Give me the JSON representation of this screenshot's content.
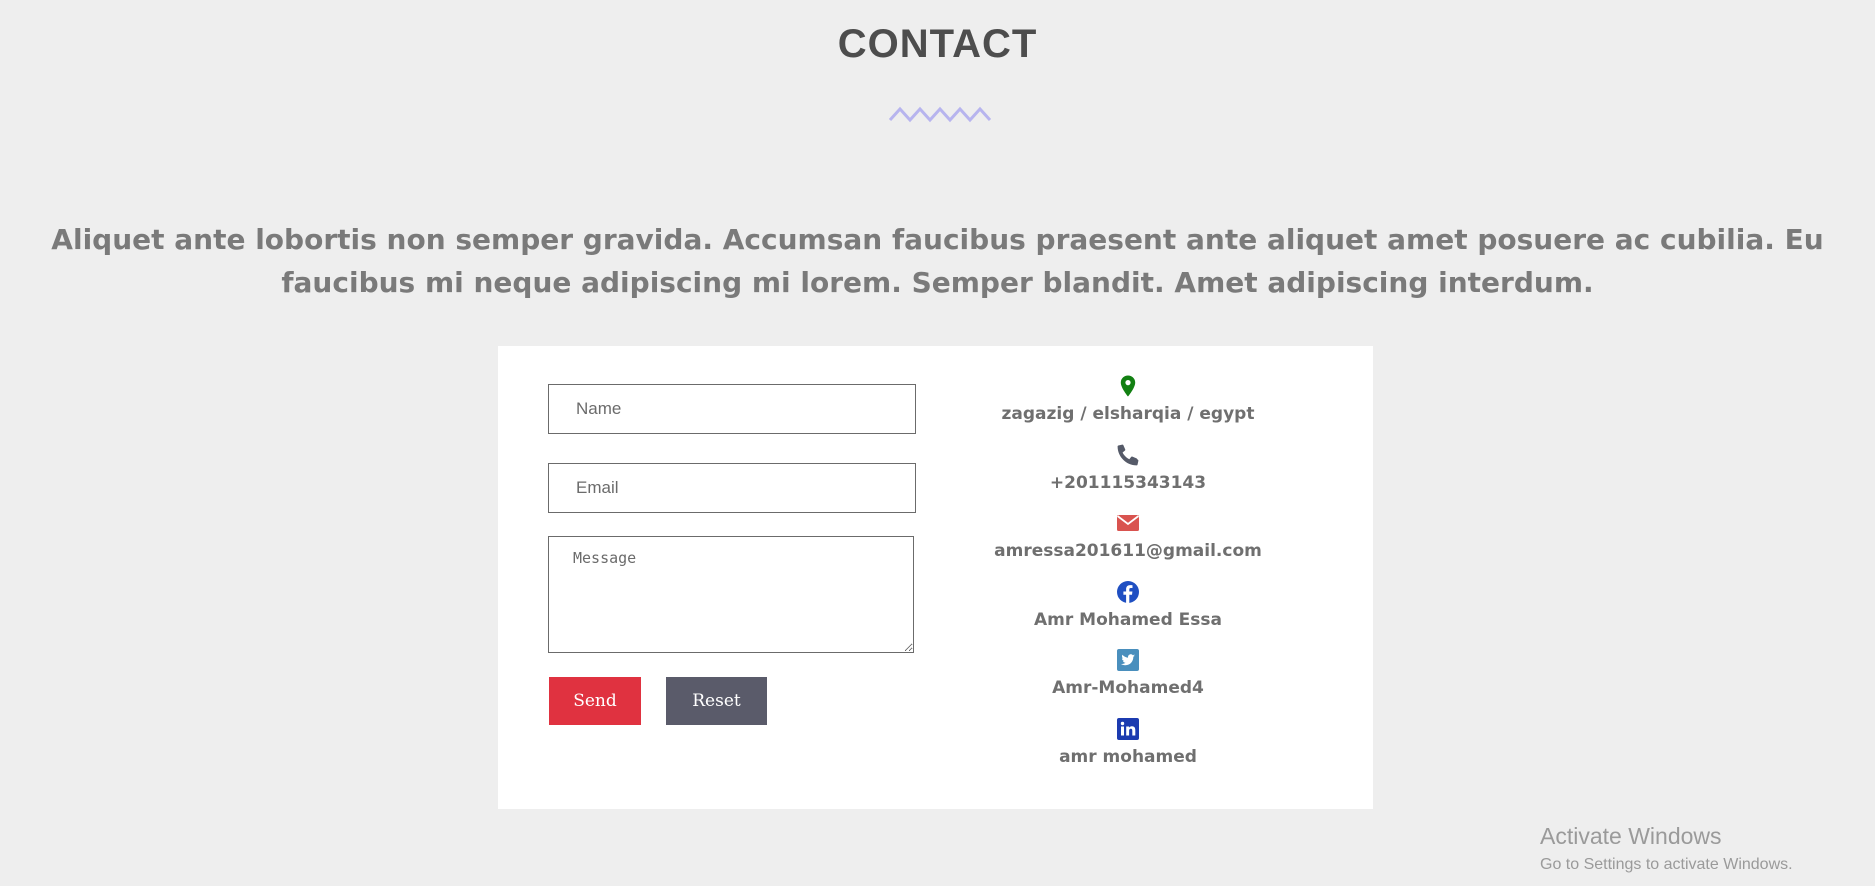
{
  "header": {
    "title": "CONTACT",
    "divider_color": "#b7b4ee"
  },
  "intro": {
    "text": "Aliquet ante lobortis non semper gravida. Accumsan faucibus praesent ante aliquet amet posuere ac cubilia. Eu faucibus mi neque adipiscing mi lorem. Semper blandit. Amet adipiscing interdum."
  },
  "form": {
    "name_placeholder": "Name",
    "email_placeholder": "Email",
    "message_placeholder": "Message",
    "send_label": "Send",
    "reset_label": "Reset",
    "send_color": "#e03240",
    "reset_color": "#5a5b6a"
  },
  "info": [
    {
      "icon": "location-pin-icon",
      "color": "#128012",
      "text": "zagazig / elsharqia / egypt"
    },
    {
      "icon": "phone-icon",
      "color": "#555a68",
      "text": "+201115343143"
    },
    {
      "icon": "envelope-icon",
      "color": "#d9534f",
      "text": "amressa201611@gmail.com"
    },
    {
      "icon": "facebook-icon",
      "color": "#1f4fc2",
      "text": "Amr Mohamed Essa"
    },
    {
      "icon": "twitter-icon",
      "color": "#4a8fbd",
      "text": "Amr-Mohamed4"
    },
    {
      "icon": "linkedin-icon",
      "color": "#1c3bb0",
      "text": "amr mohamed"
    }
  ],
  "watermark": {
    "title": "Activate Windows",
    "subtitle": "Go to Settings to activate Windows."
  }
}
